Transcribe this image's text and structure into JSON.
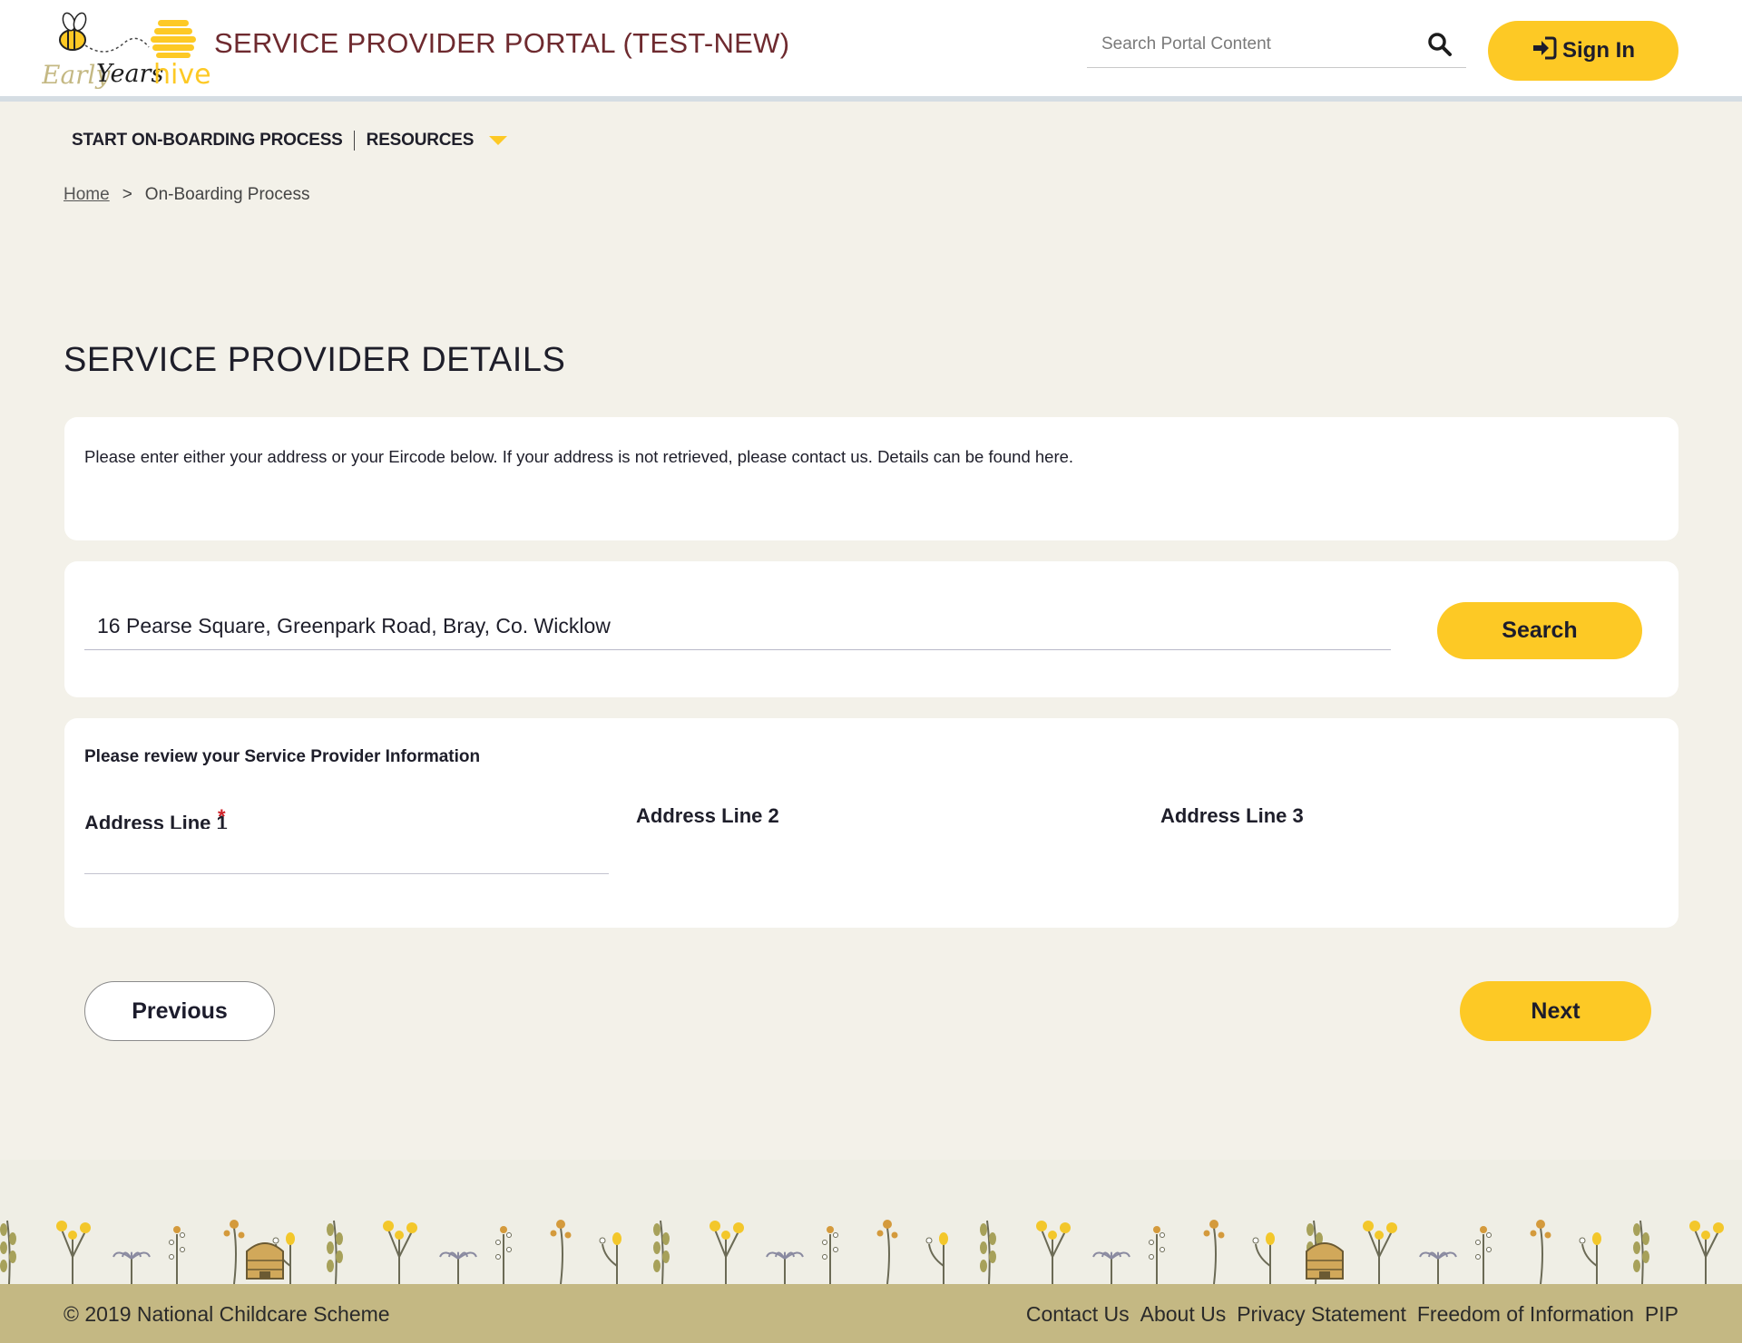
{
  "header": {
    "logo_text_early": "Early",
    "logo_text_years": "Years",
    "logo_text_hive": "hive",
    "portal_title": "SERVICE PROVIDER PORTAL (TEST-NEW)",
    "search_placeholder": "Search Portal Content",
    "search_icon": "search-icon",
    "signin_label": "Sign In",
    "signin_icon": "sign-in-icon"
  },
  "nav": {
    "items": [
      {
        "label": "START ON-BOARDING PROCESS"
      },
      {
        "label": "RESOURCES",
        "has_dropdown": true
      }
    ]
  },
  "breadcrumb": {
    "home": "Home",
    "separator": ">",
    "current": "On-Boarding Process"
  },
  "page": {
    "title": "SERVICE PROVIDER DETAILS"
  },
  "info_card": {
    "text": "Please enter either your address or your Eircode below. If your address is not retrieved, please contact us. Details can be found here."
  },
  "search_card": {
    "address_value": "16 Pearse Square, Greenpark Road, Bray, Co. Wicklow",
    "search_button": "Search"
  },
  "review_card": {
    "heading": "Please review your Service Provider Information",
    "address_line_1_label": "Address Line 1",
    "required_mark": "*",
    "address_line_2_label": "Address Line 2",
    "address_line_3_label": "Address Line 3",
    "address_line_1_value": ""
  },
  "pager": {
    "previous": "Previous",
    "next": "Next"
  },
  "footer": {
    "copyright": "© 2019 National Childcare Scheme",
    "links": [
      "Contact Us",
      "About Us",
      "Privacy Statement",
      "Freedom of Information",
      "PIP"
    ]
  },
  "colors": {
    "accent_yellow": "#fdc925",
    "title_maroon": "#6e2a2f",
    "page_bg": "#f3f1e9",
    "footer_bar": "#c4b883",
    "required_red": "#d0222a"
  }
}
